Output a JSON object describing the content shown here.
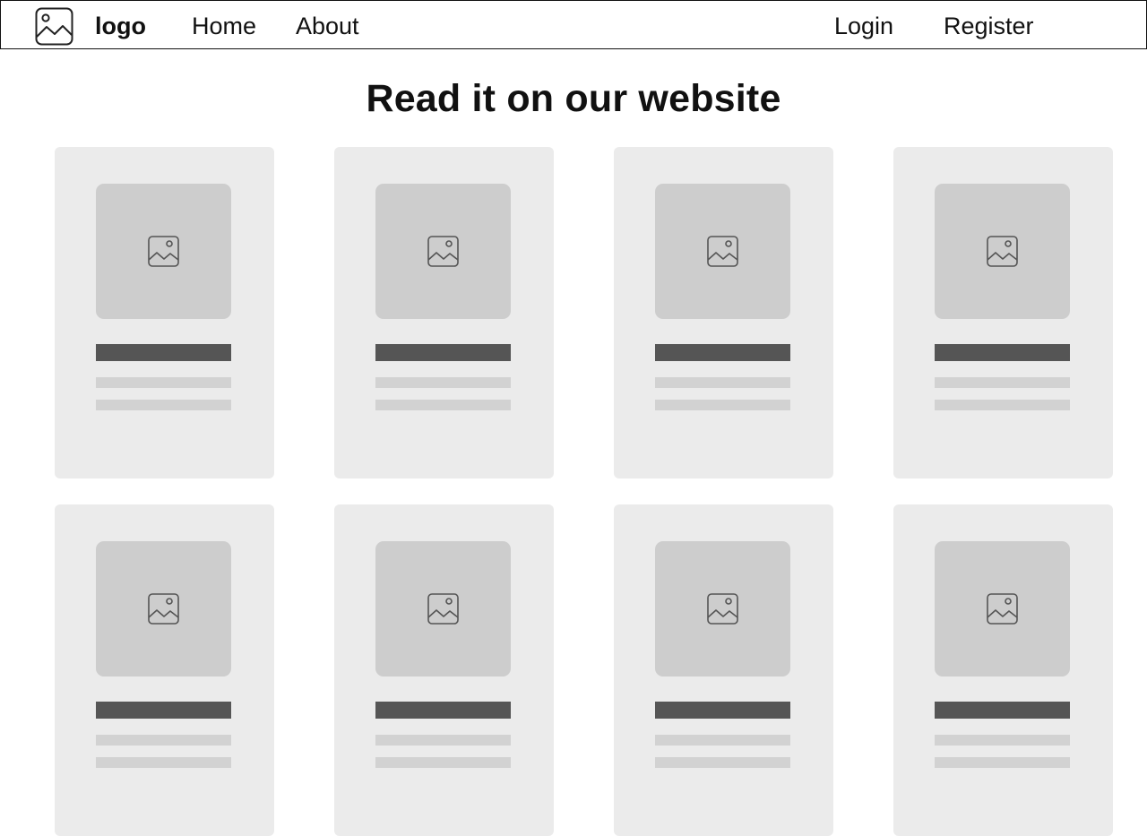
{
  "nav": {
    "logo_text": "logo",
    "links": [
      "Home",
      "About"
    ],
    "login": "Login",
    "register": "Register",
    "logo_icon": "image-placeholder-icon"
  },
  "main": {
    "title": "Read it on our website"
  },
  "cards": [
    {
      "row": 1,
      "col": 1,
      "icon": "image-placeholder-icon"
    },
    {
      "row": 1,
      "col": 2,
      "icon": "image-placeholder-icon"
    },
    {
      "row": 1,
      "col": 3,
      "icon": "image-placeholder-icon"
    },
    {
      "row": 1,
      "col": 4,
      "icon": "image-placeholder-icon"
    },
    {
      "row": 2,
      "col": 1,
      "icon": "image-placeholder-icon"
    },
    {
      "row": 2,
      "col": 2,
      "icon": "image-placeholder-icon"
    },
    {
      "row": 2,
      "col": 3,
      "icon": "image-placeholder-icon"
    },
    {
      "row": 2,
      "col": 4,
      "icon": "image-placeholder-icon"
    }
  ],
  "colors": {
    "card_bg": "#ebebeb",
    "thumb_bg": "#cdcdcd",
    "title_bar": "#555555",
    "text_bar": "#d2d2d2",
    "border": "#111111"
  }
}
